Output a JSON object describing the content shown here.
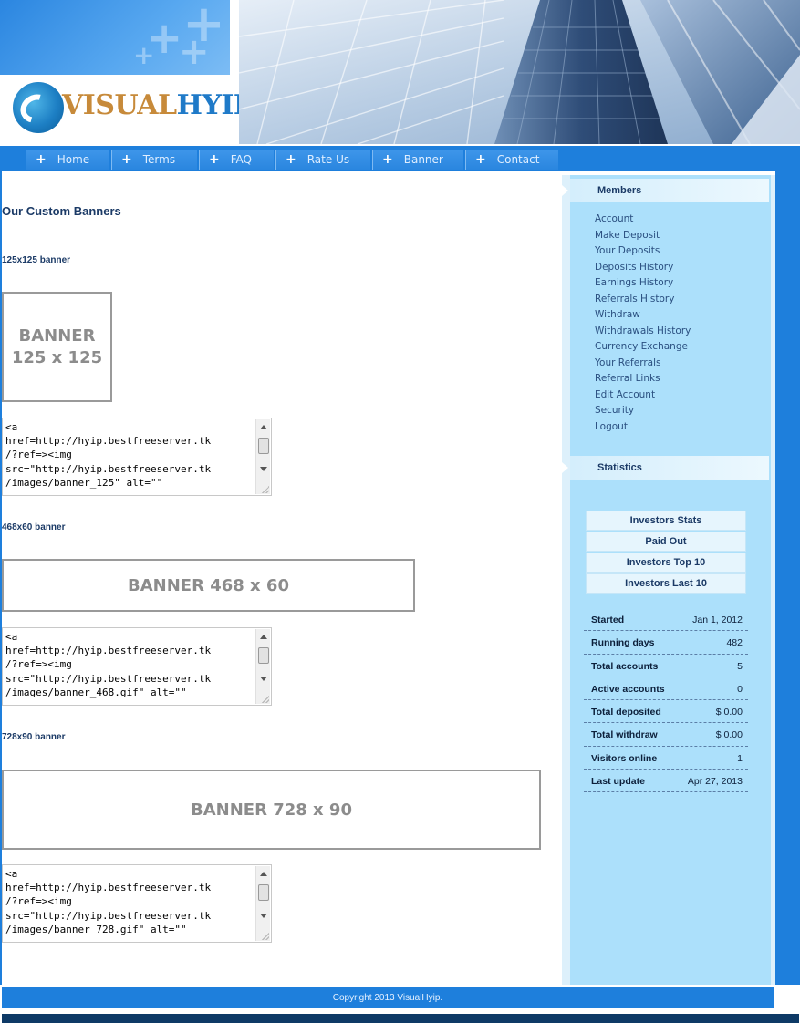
{
  "brand": {
    "logo_part1": "VISUAL",
    "logo_part2": "HYIP"
  },
  "nav": {
    "tabs": [
      {
        "label": "Home"
      },
      {
        "label": "Terms"
      },
      {
        "label": "FAQ"
      },
      {
        "label": "Rate Us"
      },
      {
        "label": "Banner"
      },
      {
        "label": "Contact"
      }
    ]
  },
  "main": {
    "title": "Our Custom Banners",
    "banners": [
      {
        "heading": "125x125 banner",
        "label_line1": "BANNER",
        "label_line2": "125 x 125",
        "code_lines": [
          "<a",
          "href=http://hyip.bestfreeserver.tk",
          "/?ref=><img",
          "src=\"http://hyip.bestfreeserver.tk",
          "/images/banner_125\" alt=\"\""
        ]
      },
      {
        "heading": "468x60 banner",
        "label": "BANNER 468 x 60",
        "code_lines": [
          "<a",
          "href=http://hyip.bestfreeserver.tk",
          "/?ref=><img",
          "src=\"http://hyip.bestfreeserver.tk",
          "/images/banner_468.gif\" alt=\"\""
        ]
      },
      {
        "heading": "728x90 banner",
        "label": "BANNER 728 x 90",
        "code_lines": [
          "<a",
          "href=http://hyip.bestfreeserver.tk",
          "/?ref=><img",
          "src=\"http://hyip.bestfreeserver.tk",
          "/images/banner_728.gif\" alt=\"\""
        ]
      }
    ]
  },
  "sidebar": {
    "members_title": "Members",
    "member_links": [
      "Account",
      "Make Deposit",
      "Your Deposits",
      "Deposits History",
      "Earnings History",
      "Referrals History",
      "Withdraw",
      "Withdrawals History",
      "Currency Exchange",
      "Your Referrals",
      "Referral Links",
      "Edit Account",
      "Security",
      "Logout"
    ],
    "statistics_title": "Statistics",
    "stat_buttons": [
      "Investors Stats",
      "Paid Out",
      "Investors Top 10",
      "Investors Last 10"
    ],
    "stats": [
      {
        "key": "Started",
        "value": "Jan 1, 2012"
      },
      {
        "key": "Running days",
        "value": "482"
      },
      {
        "key": "Total accounts",
        "value": "5"
      },
      {
        "key": "Active accounts",
        "value": "0"
      },
      {
        "key": "Total deposited",
        "value": "$ 0.00"
      },
      {
        "key": "Total withdraw",
        "value": "$ 0.00"
      },
      {
        "key": "Visitors online",
        "value": "1"
      },
      {
        "key": "Last update",
        "value": "Apr 27, 2013"
      }
    ]
  },
  "footer": {
    "copyright": "Copyright 2013 VisualHyip."
  },
  "colors": {
    "brand_blue": "#1e7fdc",
    "sidebar_bg": "#ace0fb",
    "logo_gold": "#c78a3a"
  }
}
